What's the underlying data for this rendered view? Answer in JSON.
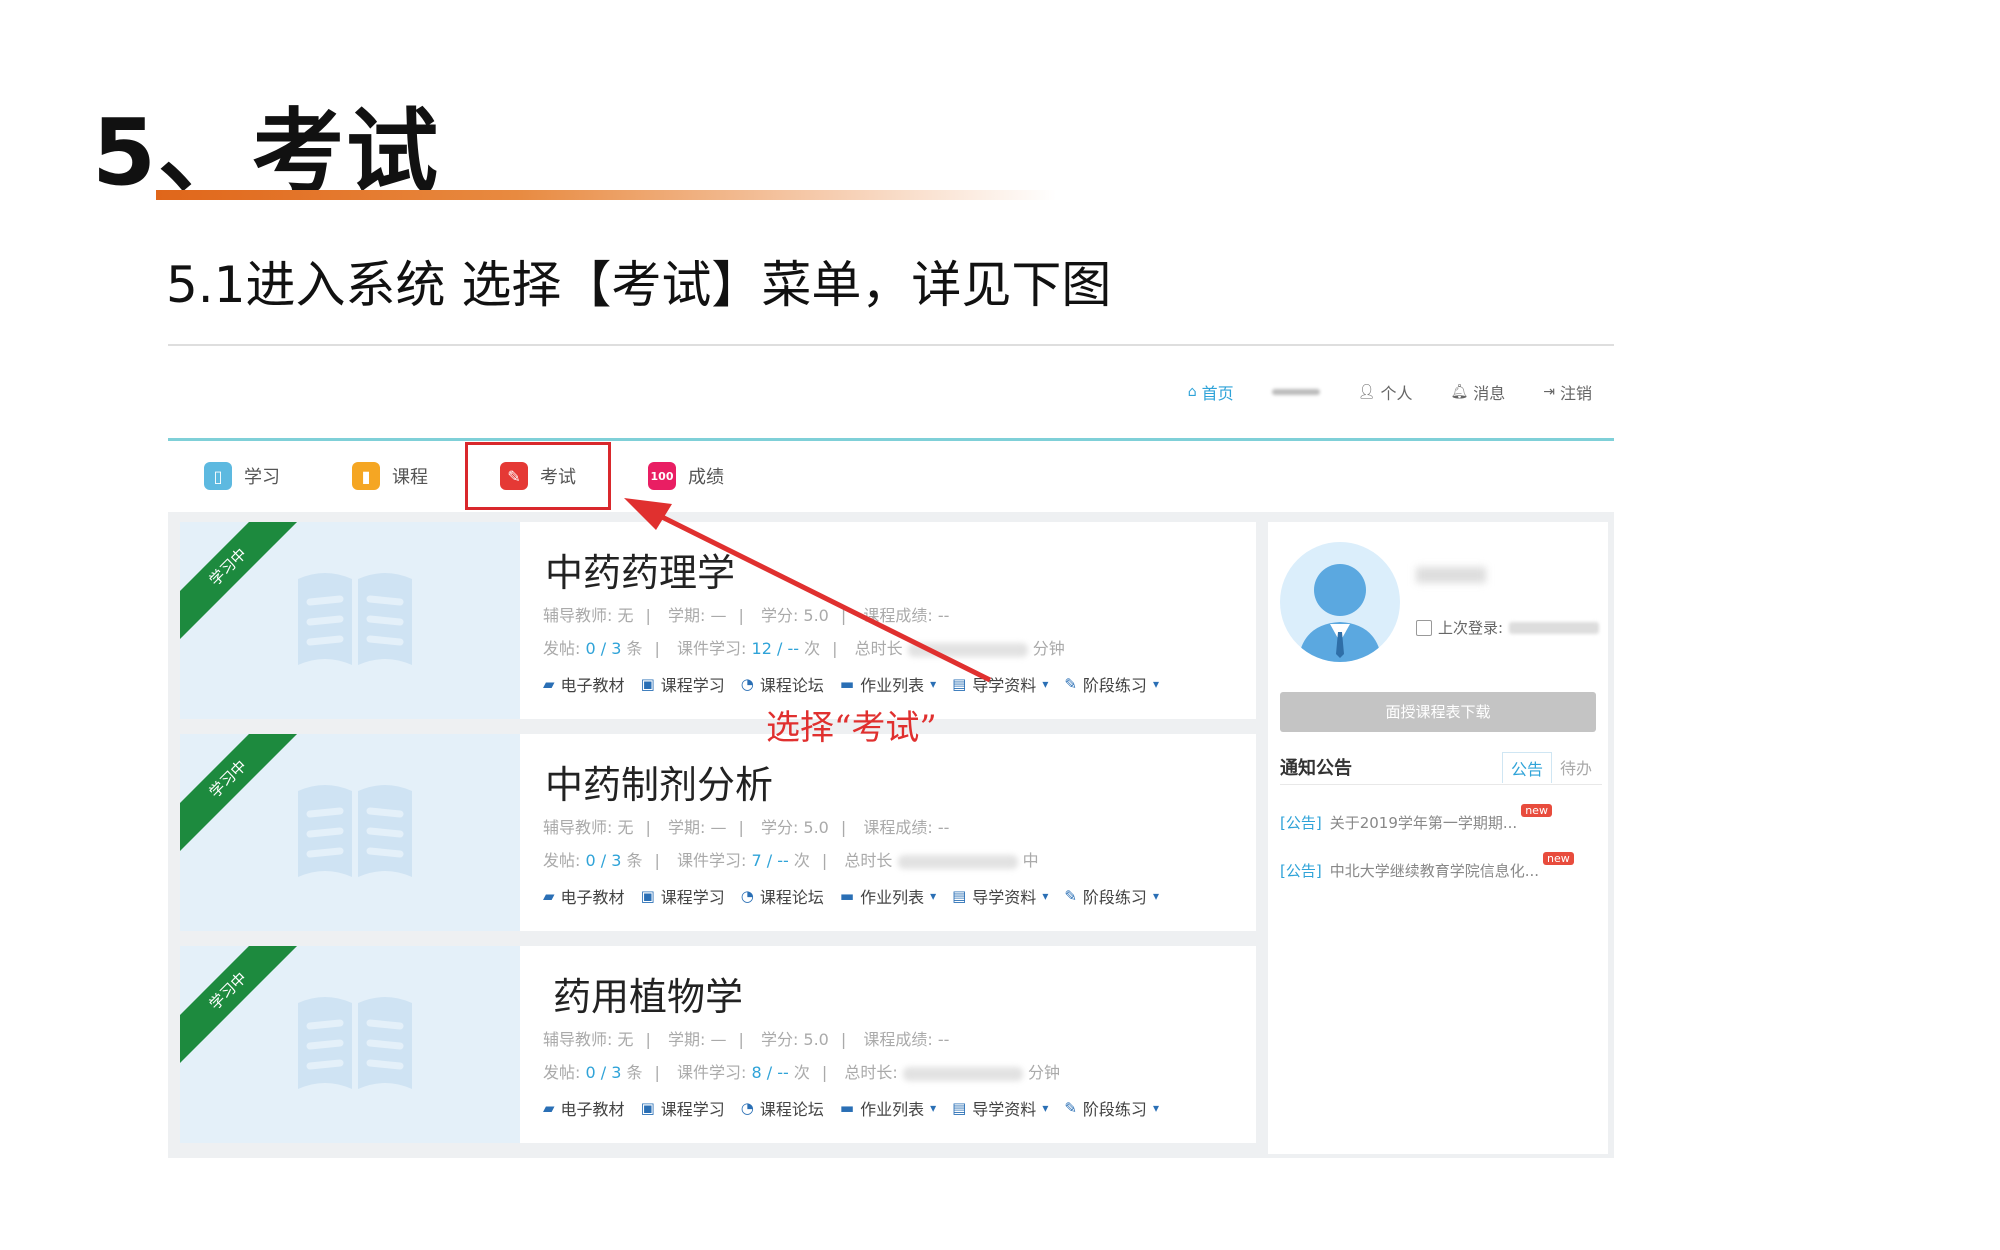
{
  "slide": {
    "title": "5、考试",
    "subtitle": "5.1进入系统 选择【考试】菜单，详见下图"
  },
  "topbar": {
    "links": [
      {
        "label": "首页",
        "icon": "home-icon",
        "active": true
      },
      {
        "label": "",
        "icon": "blurred-icon"
      },
      {
        "label": "个人",
        "icon": "user-icon"
      },
      {
        "label": "消息",
        "icon": "bell-icon"
      },
      {
        "label": "注销",
        "icon": "logout-icon"
      }
    ]
  },
  "nav": {
    "items": [
      {
        "label": "学习",
        "icon": "book-open-icon",
        "color": "#5db9e0"
      },
      {
        "label": "课程",
        "icon": "course-icon",
        "color": "#f5a623"
      },
      {
        "label": "考试",
        "icon": "pencil-icon",
        "color": "#e53935",
        "selected": true
      },
      {
        "label": "成绩",
        "icon": "score-100-icon",
        "color": "#e91e63"
      }
    ]
  },
  "courses": [
    {
      "ribbon": "学习中",
      "title": "中药药理学",
      "teacher": "辅导教师: 无",
      "term": "学期: —",
      "credit": "学分: 5.0",
      "grade": "课程成绩: --",
      "posts_label": "发帖:",
      "posts_value": "0 / 3",
      "posts_unit": "条",
      "study_label": "课件学习:",
      "study_value": "12 / --",
      "study_unit": "次",
      "duration_label": "总时长",
      "duration_tail": "分钟"
    },
    {
      "ribbon": "学习中",
      "title": "中药制剂分析",
      "teacher": "辅导教师: 无",
      "term": "学期: —",
      "credit": "学分: 5.0",
      "grade": "课程成绩: --",
      "posts_label": "发帖:",
      "posts_value": "0 / 3",
      "posts_unit": "条",
      "study_label": "课件学习:",
      "study_value": "7 / --",
      "study_unit": "次",
      "duration_label": "总时长",
      "duration_tail": "中"
    },
    {
      "ribbon": "学习中",
      "title": "药用植物学",
      "teacher": "辅导教师: 无",
      "term": "学期: —",
      "credit": "学分: 5.0",
      "grade": "课程成绩: --",
      "posts_label": "发帖:",
      "posts_value": "0 / 3",
      "posts_unit": "条",
      "study_label": "课件学习:",
      "study_value": "8 / --",
      "study_unit": "次",
      "duration_label": "总时长:",
      "duration_tail": "分钟"
    }
  ],
  "course_actions": [
    "电子教材",
    "课程学习",
    "课程论坛",
    "作业列表",
    "导学资料",
    "阶段练习"
  ],
  "sidebar": {
    "last_login_label": "上次登录:",
    "download_button": "面授课程表下载",
    "notice_title": "通知公告",
    "tabs": [
      "公告",
      "待办"
    ],
    "notices": [
      {
        "tag": "[公告]",
        "text": "关于2019学年第一学期期...",
        "badge": "new"
      },
      {
        "tag": "[公告]",
        "text": "中北大学继续教育学院信息化...",
        "badge": "new"
      }
    ]
  },
  "annotation": {
    "text": "选择“考试”",
    "color": "#e0302f"
  }
}
